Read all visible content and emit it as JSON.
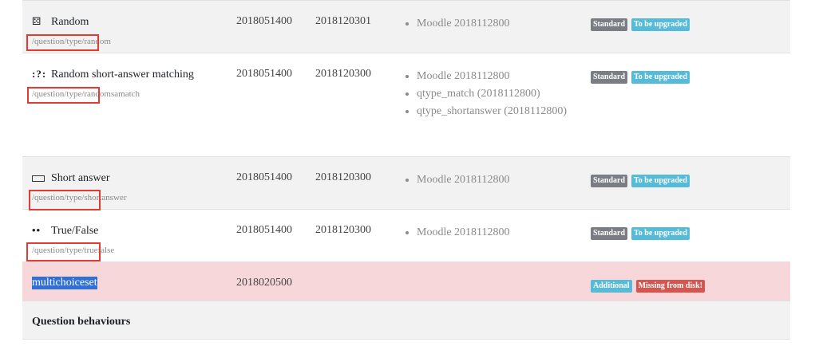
{
  "rows": [
    {
      "name": "Random",
      "icon": "dice-icon",
      "path": "/question/type/random",
      "version": "2018051400",
      "requires": "2018120301",
      "deps": [
        "Moodle 2018112800"
      ],
      "badges": [
        "Standard",
        "To be upgraded"
      ]
    },
    {
      "name": "Random short-answer matching",
      "icon": "matching-icon",
      "path": "/question/type/randomsamatch",
      "version": "2018051400",
      "requires": "2018120300",
      "deps": [
        "Moodle 2018112800",
        "qtype_match (2018112800)",
        "qtype_shortanswer (2018112800)"
      ],
      "badges": [
        "Standard",
        "To be upgraded"
      ]
    },
    {
      "name": "Short answer",
      "icon": "text-field-icon",
      "path": "/question/type/shortanswer",
      "version": "2018051400",
      "requires": "2018120300",
      "deps": [
        "Moodle 2018112800"
      ],
      "badges": [
        "Standard",
        "To be upgraded"
      ]
    },
    {
      "name": "True/False",
      "icon": "two-dots-icon",
      "path": "/question/type/truefalse",
      "version": "2018051400",
      "requires": "2018120300",
      "deps": [
        "Moodle 2018112800"
      ],
      "badges": [
        "Standard",
        "To be upgraded"
      ]
    }
  ],
  "missing": {
    "name": "multichoiceset",
    "version": "2018020500",
    "badges": [
      "Additional",
      "Missing from disk!"
    ]
  },
  "section": {
    "title": "Question behaviours"
  },
  "colors": {
    "badge_standard": "#7a7e84",
    "badge_upgrade": "#56bbd9",
    "badge_missing": "#d6554f",
    "row_danger": "#f8d7da",
    "highlight_box": "#e23b32"
  }
}
